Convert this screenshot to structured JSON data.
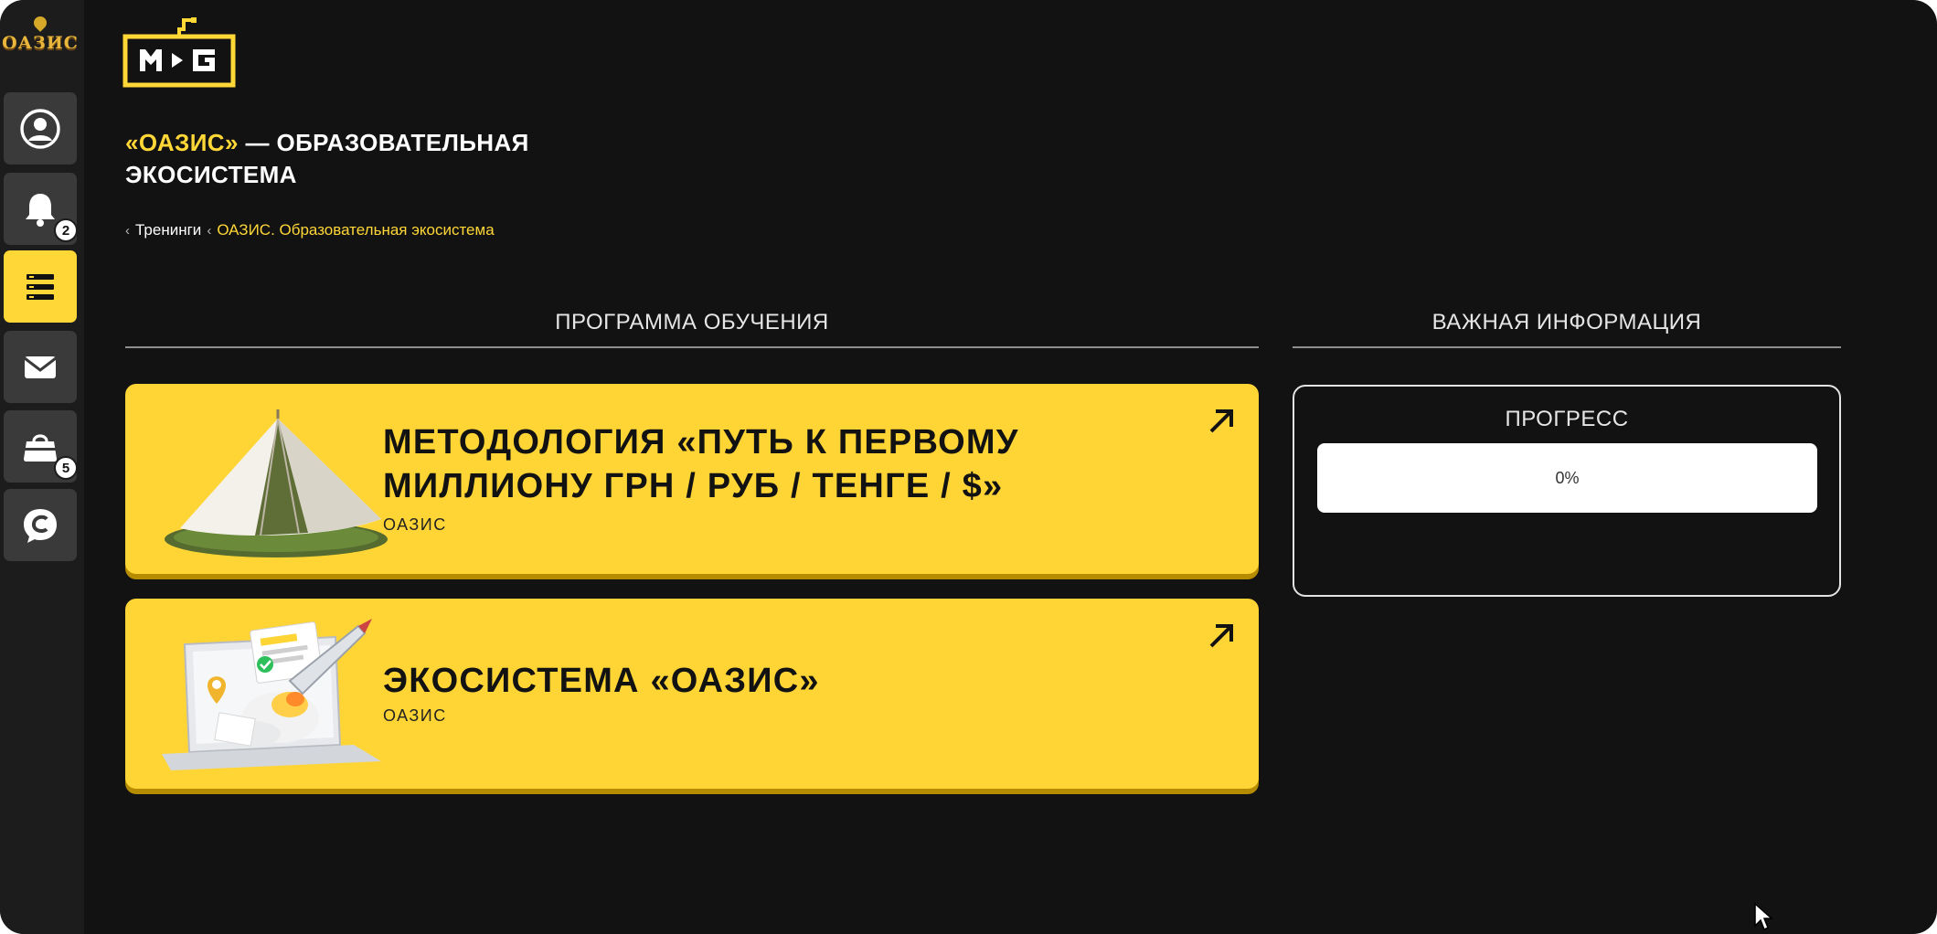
{
  "sidebar": {
    "logo_text": "ОАЗИС",
    "items": [
      {
        "id": "profile",
        "icon": "user-circle-icon"
      },
      {
        "id": "notifications",
        "icon": "bell-icon",
        "badge": "2"
      },
      {
        "id": "trainings",
        "icon": "list-icon",
        "active": true
      },
      {
        "id": "messages",
        "icon": "envelope-icon"
      },
      {
        "id": "shop",
        "icon": "shopping-bag-icon",
        "badge": "5"
      },
      {
        "id": "chat",
        "icon": "chat-bubble-icon"
      }
    ]
  },
  "header": {
    "title_accent": "«ОАЗИС»",
    "title_rest": " — ОБРАЗОВАТЕЛЬНАЯ ЭКОСИСТЕМА"
  },
  "breadcrumb": {
    "items": [
      "Тренинги",
      "ОАЗИС. Образовательная экосистема"
    ]
  },
  "sections": {
    "program": "ПРОГРАММА ОБУЧЕНИЯ",
    "info": "ВАЖНАЯ ИНФОРМАЦИЯ"
  },
  "modules": [
    {
      "title": "МЕТОДОЛОГИЯ «ПУТЬ К ПЕРВОМУ МИЛЛИОНУ ГРН / РУБ / ТЕНГЕ / $»",
      "subtitle": "ОАЗИС",
      "image": "tent-image"
    },
    {
      "title": "ЭКОСИСТЕМА «ОАЗИС»",
      "subtitle": "ОАЗИС",
      "image": "laptop-rocket-image"
    }
  ],
  "progress": {
    "title": "ПРОГРЕСС",
    "percent": 0,
    "label": "0%"
  },
  "colors": {
    "background": "#131213",
    "sidebar": "#1c1c1c",
    "accent": "#ffd536",
    "sidebar_button": "#3a3a3a"
  }
}
